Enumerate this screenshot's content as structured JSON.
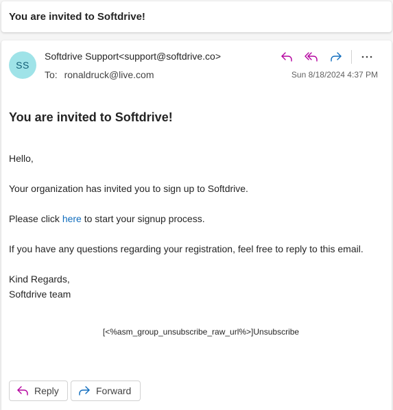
{
  "subject": "You are invited to Softdrive!",
  "sender": {
    "initials": "SS",
    "display": "Softdrive Support<support@softdrive.co>"
  },
  "recipients": {
    "label": "To:",
    "value": "ronaldruck@live.com"
  },
  "timestamp": "Sun 8/18/2024 4:37 PM",
  "icons": {
    "reply": "reply-icon",
    "reply_all": "reply-all-icon",
    "forward": "forward-icon",
    "more": "more-icon"
  },
  "colors": {
    "avatar_bg": "#9fe3e8",
    "avatar_text": "#0f5b73",
    "reply_icon": "#b4009e",
    "forward_icon": "#0f6cbd",
    "link": "#0f6cbd"
  },
  "body": {
    "heading": "You are invited to Softdrive!",
    "greeting": "Hello,",
    "line1": "Your organization has invited you to sign up to Softdrive.",
    "line2_before": "Please click ",
    "line2_link": "here",
    "line2_after": " to start your signup process.",
    "line3": "If you have any questions regarding your registration, feel free to reply to this email.",
    "closing": "Kind Regards,",
    "signature": "Softdrive team",
    "unsubscribe": "[<%asm_group_unsubscribe_raw_url%>]Unsubscribe"
  },
  "footer": {
    "reply_label": "Reply",
    "forward_label": "Forward"
  }
}
